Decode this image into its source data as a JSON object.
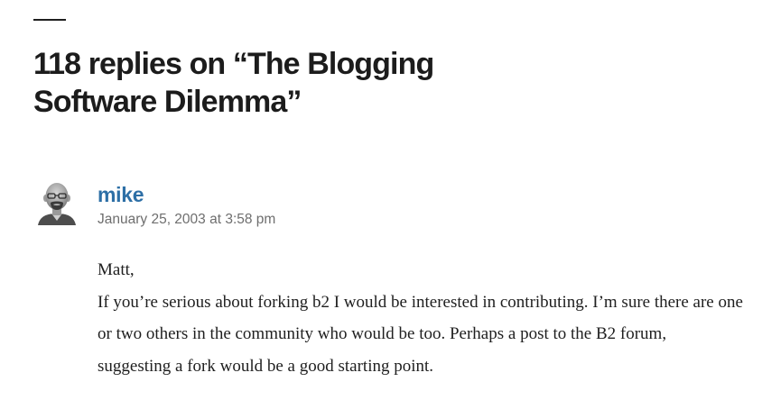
{
  "comments_section": {
    "heading": "118 replies on “The Blogging Software Dilemma”"
  },
  "comment": {
    "author": "mike",
    "date": "January 25, 2003 at 3:58 pm",
    "avatar_icon": "user-avatar-icon",
    "greeting": "Matt,",
    "text": "If you’re serious about forking b2 I would be interested in contributing. I’m sure there are one or two others in the community who would be too. Perhaps a post to the B2 forum, suggesting a fork would be a good starting point."
  },
  "colors": {
    "author_link": "#2d6fa6",
    "date_text": "#6e6e6e",
    "heading_text": "#1c1c1c"
  }
}
